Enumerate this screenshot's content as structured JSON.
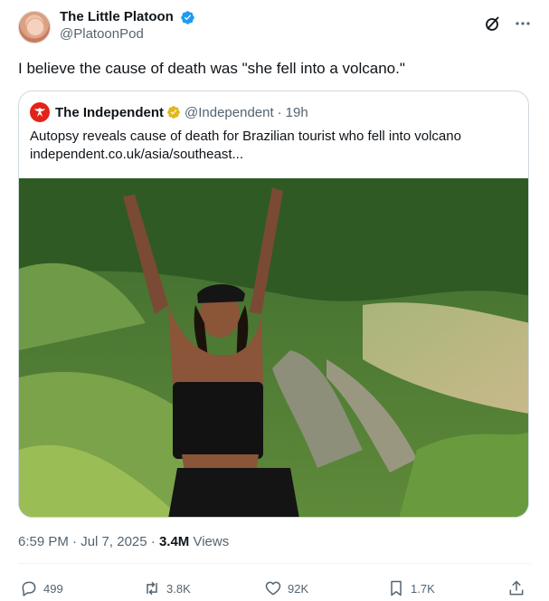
{
  "author": {
    "display_name": "The Little Platoon",
    "handle": "@PlatoonPod",
    "verified": true
  },
  "tweet": {
    "text": "I believe the cause of death was \"she fell into a volcano.\""
  },
  "quoted": {
    "display_name": "The Independent",
    "handle": "@Independent",
    "separator": "·",
    "time": "19h",
    "text": "Autopsy reveals cause of death for Brazilian tourist who fell into volcano",
    "link": "independent.co.uk/asia/southeast..."
  },
  "meta": {
    "time": "6:59 PM",
    "separator": "·",
    "date": "Jul 7, 2025",
    "views_count": "3.4M",
    "views_label": "Views"
  },
  "actions": {
    "replies": "499",
    "reposts": "3.8K",
    "likes": "92K",
    "bookmarks": "1.7K"
  },
  "colors": {
    "verified_blue": "#1d9bf0",
    "gold": "#e2b719",
    "text": "#0f1419",
    "muted": "#536471",
    "border": "#cfd9de"
  },
  "icons": [
    "grok-icon",
    "more-icon",
    "reply-icon",
    "repost-icon",
    "like-icon",
    "bookmark-icon",
    "share-icon"
  ]
}
